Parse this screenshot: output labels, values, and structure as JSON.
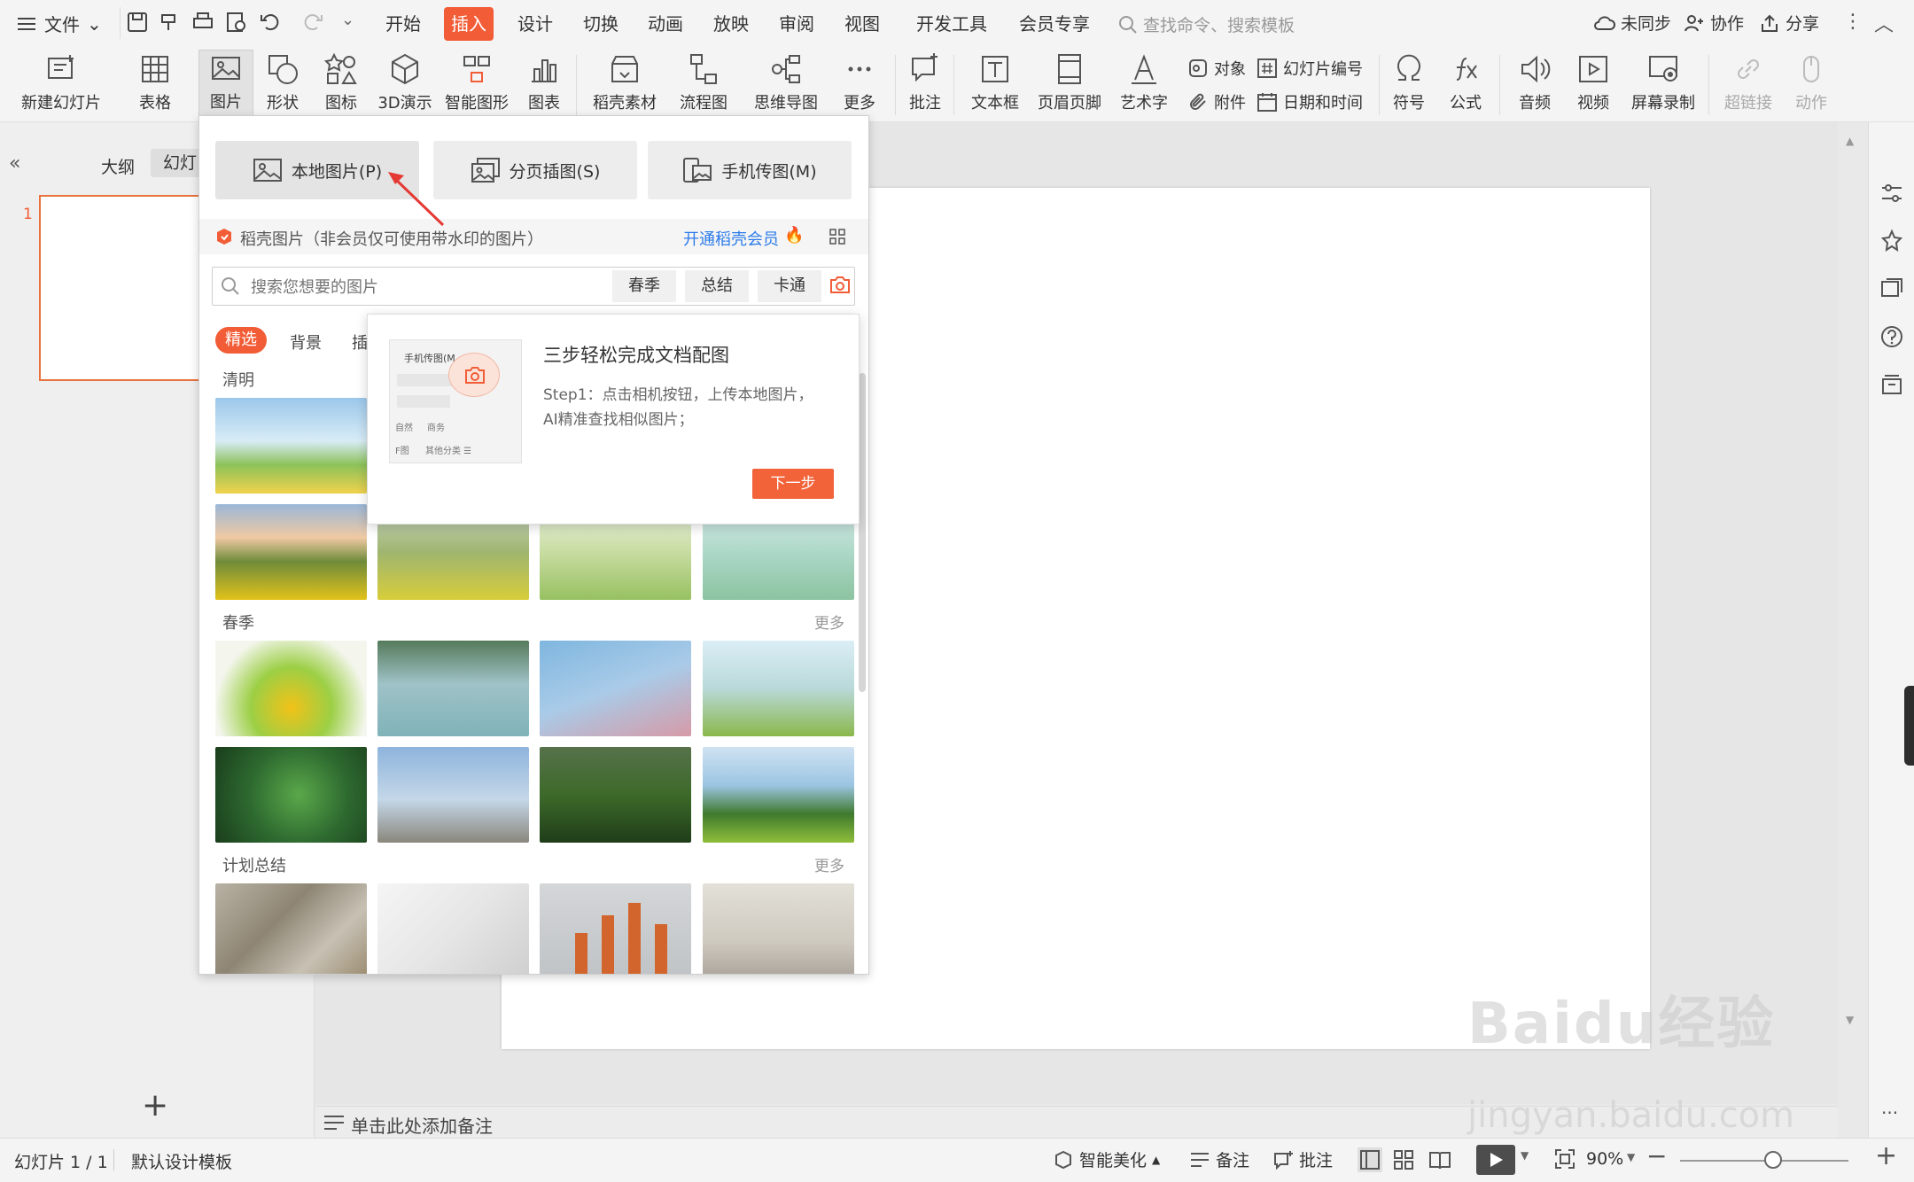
{
  "menubar": {
    "file_label": "文件",
    "tabs": [
      "开始",
      "插入",
      "设计",
      "切换",
      "动画",
      "放映",
      "审阅",
      "视图",
      "开发工具",
      "会员专享"
    ],
    "search_placeholder": "查找命令、搜索模板",
    "sync_label": "未同步",
    "collab_label": "协作",
    "share_label": "分享"
  },
  "ribbon": {
    "new_slide": "新建幻灯片",
    "table": "表格",
    "picture": "图片",
    "shape": "形状",
    "icon": "图标",
    "3d": "3D演示",
    "smartart": "智能图形",
    "chart": "图表",
    "material": "稻壳素材",
    "flowchart": "流程图",
    "mindmap": "思维导图",
    "more": "更多",
    "comment": "批注",
    "textbox": "文本框",
    "header_footer": "页眉页脚",
    "wordart": "艺术字",
    "object": "对象",
    "attachment": "附件",
    "slide_number": "幻灯片编号",
    "datetime": "日期和时间",
    "symbol": "符号",
    "formula": "公式",
    "audio": "音频",
    "video": "视频",
    "screen_record": "屏幕录制",
    "hyperlink": "超链接",
    "action": "动作"
  },
  "leftpane": {
    "outline_tab": "大纲",
    "slides_tab": "幻灯",
    "slide_number": "1"
  },
  "dropdown": {
    "local_picture": "本地图片(P)",
    "paged_insert": "分页插图(S)",
    "phone_upload": "手机传图(M)",
    "docer_notice": "稻壳图片（非会员仅可使用带水印的图片）",
    "open_membership": "开通稻壳会员",
    "search_placeholder": "搜索您想要的图片",
    "tags": [
      "春季",
      "总结",
      "卡通"
    ],
    "categories": [
      "精选",
      "背景",
      "插"
    ],
    "sections": [
      {
        "title": "清明",
        "more": ""
      },
      {
        "title": "春季",
        "more": "更多"
      },
      {
        "title": "计划总结",
        "more": "更多"
      }
    ]
  },
  "popup": {
    "title": "三步轻松完成文档配图",
    "body_line1": "Step1：点击相机按钮，上传本地图片，",
    "body_line2": "AI精准查找相似图片；",
    "next_button": "下一步",
    "preview_label1": "手机传图(M",
    "preview_label2": "自然",
    "preview_label3": "商务",
    "preview_label4": "F图",
    "preview_label5": "其他分类 ☰"
  },
  "notes": {
    "placeholder": "单击此处添加备注"
  },
  "status": {
    "slide_info": "幻灯片 1 / 1",
    "template": "默认设计模板",
    "beautify": "智能美化",
    "notes": "备注",
    "comments": "批注",
    "zoom": "90%",
    "zoom_fraction": 0.55
  },
  "watermark": {
    "text1": "Baidu经验",
    "text2": "jingyan.baidu.com"
  },
  "colors": {
    "accent": "#f25c36",
    "link": "#2b7bea"
  }
}
